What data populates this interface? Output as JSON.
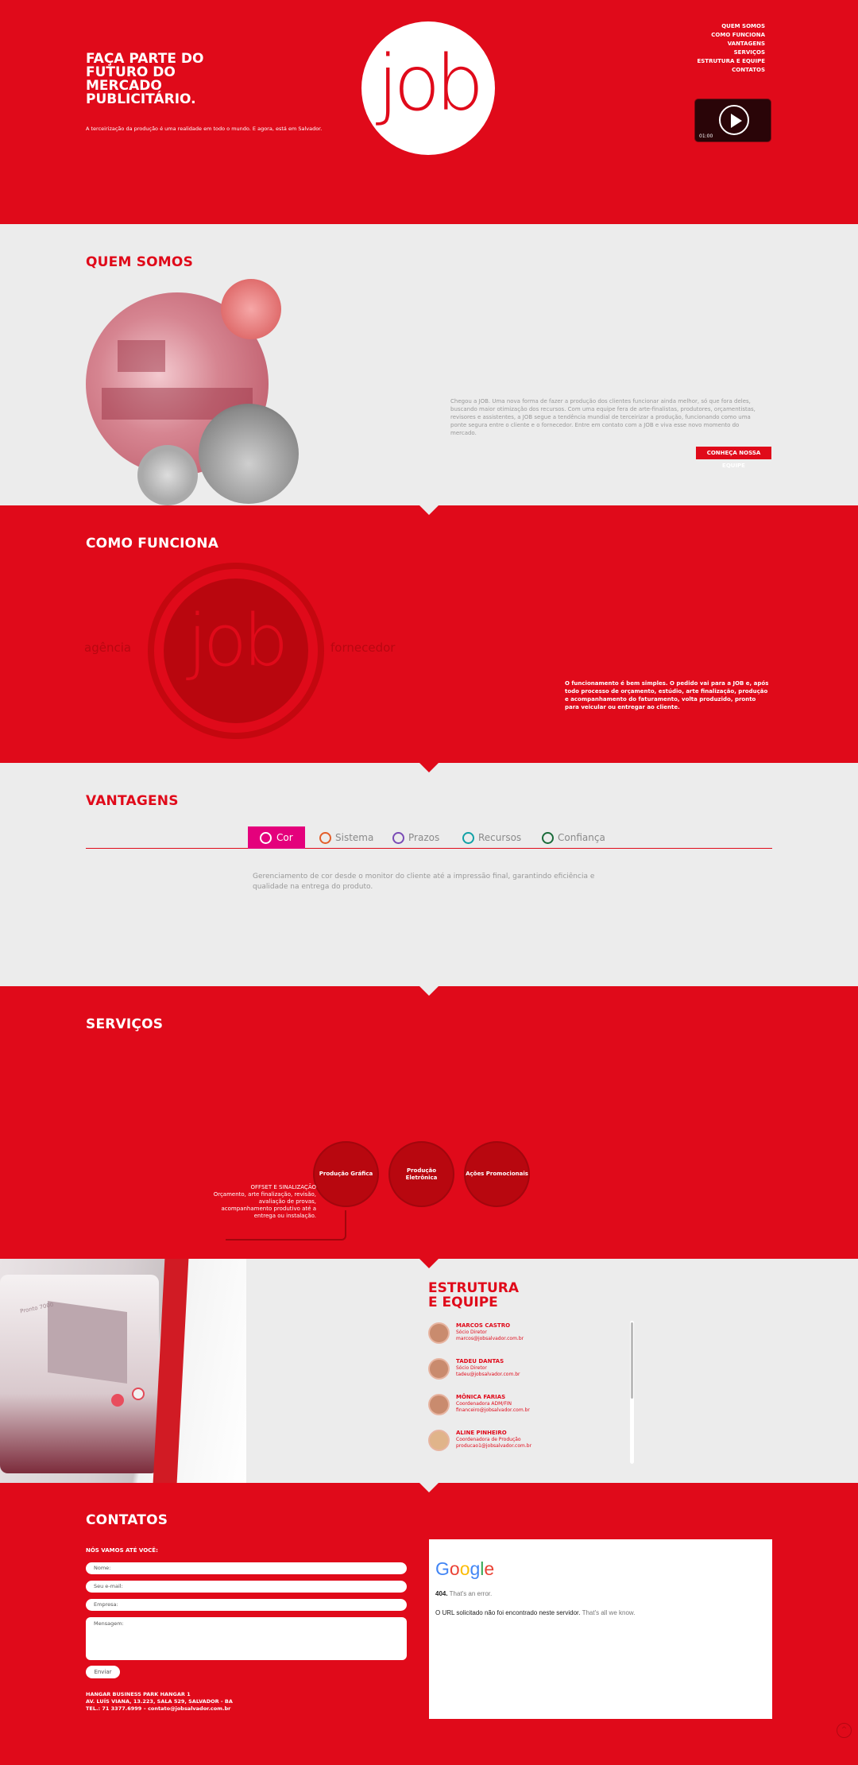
{
  "hero": {
    "title": "FAÇA PARTE DO FUTURO DO MERCADO PUBLICITÁRIO.",
    "subtitle": "A terceirização da produção é uma realidade em todo o mundo. E agora, está em Salvador.",
    "logo": "job",
    "nav": [
      "QUEM SOMOS",
      "COMO FUNCIONA",
      "VANTAGENS",
      "SERVIÇOS",
      "ESTRUTURA E EQUIPE",
      "CONTATOS"
    ],
    "video_time": "01:00"
  },
  "quem": {
    "title": "QUEM SOMOS",
    "text": "Chegou a JOB. Uma nova forma de fazer a produção dos clientes funcionar ainda melhor, só que fora deles, buscando maior otimização dos recursos. Com uma equipe fera de arte-finalistas, produtores, orçamentistas, revisores e assistentes, a JOB segue a tendência mundial de terceirizar a produção, funcionando como uma ponte segura entre o cliente e o fornecedor. Entre em contato com a JOB e viva esse novo momento do mercado.",
    "button": "CONHEÇA NOSSA EQUIPE"
  },
  "como": {
    "title": "COMO FUNCIONA",
    "logo": "job",
    "left_word": "agência",
    "right_word": "fornecedor",
    "text": "O funcionamento é bem simples. O pedido vai para a JOB e, após todo processo de orçamento, estúdio, arte finalização, produção e acompanhamento do faturamento, volta produzido, pronto para veicular ou entregar ao cliente."
  },
  "vantagens": {
    "title": "VANTAGENS",
    "tabs": [
      "Cor",
      "Sistema",
      "Prazos",
      "Recursos",
      "Confiança"
    ],
    "active_tab": "Cor",
    "text": "Gerenciamento de cor desde o monitor do cliente até a impressão final, garantindo eficiência e qualidade na entrega do produto."
  },
  "servicos": {
    "title": "SERVIÇOS",
    "items": [
      "Produção Gráfica",
      "Produção Eletrônica",
      "Ações Promocionais"
    ],
    "desc_title": "OFFSET E SINALIZAÇÃO",
    "desc": "Orçamento, arte finalização, revisão, avaliação de provas, acompanhamento produtivo até a entrega ou instalação."
  },
  "estrutura": {
    "title_line1": "ESTRUTURA",
    "title_line2": "E EQUIPE",
    "machine_label": "Pronto 7000",
    "team": [
      {
        "name": "MARCOS CASTRO",
        "role": "Sócio Diretor",
        "email": "marcos@jobsalvador.com.br"
      },
      {
        "name": "TADEU DANTAS",
        "role": "Sócio Diretor",
        "email": "tadeu@jobsalvador.com.br"
      },
      {
        "name": "MÔNICA FARIAS",
        "role": "Coordenadora ADM/FIN",
        "email": "financeiro@jobsalvador.com.br"
      },
      {
        "name": "ALINE PINHEIRO",
        "role": "Coordenadora de Produção",
        "email": "producao1@jobsalvador.com.br"
      }
    ]
  },
  "contatos": {
    "title": "CONTATOS",
    "form_label": "NÓS VAMOS ATÉ VOCÊ:",
    "fields": [
      "Nome:",
      "Seu e-mail:",
      "Empresa:",
      "Mensagem:"
    ],
    "send": "Enviar",
    "address": [
      "HANGAR BUSINESS PARK HANGAR 1",
      "AV. LUÍS VIANA, 13.223, SALA 529, SALVADOR - BA",
      "TEL.: 71 3377.6999 – contato@jobsalvador.com.br"
    ],
    "map": {
      "logo": "Google",
      "code": "404.",
      "code_note": "That's an error.",
      "message": "O URL solicitado não foi encontrado neste servidor.",
      "message_note": "That's all we know."
    }
  },
  "colors": {
    "brand_red": "#e00a1a",
    "grey_bg": "#ececec",
    "tab_active": "#e4017c"
  }
}
